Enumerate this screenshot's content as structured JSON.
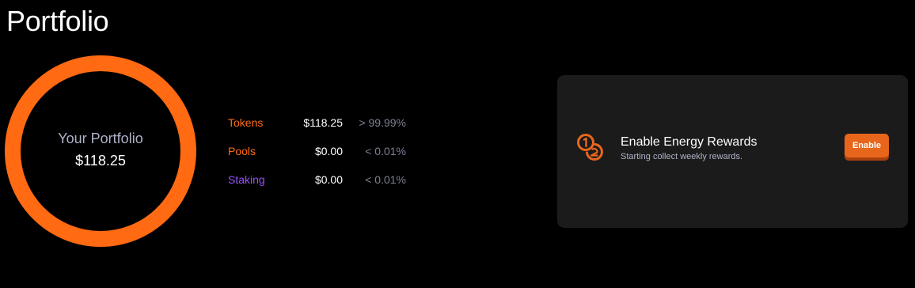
{
  "page": {
    "title": "Portfolio"
  },
  "portfolio": {
    "label": "Your Portfolio",
    "total": "$118.25"
  },
  "breakdown": [
    {
      "name": "Tokens",
      "amount": "$118.25",
      "percent": "> 99.99%",
      "color": "#ff6a13"
    },
    {
      "name": "Pools",
      "amount": "$0.00",
      "percent": "< 0.01%",
      "color": "#ff6a13"
    },
    {
      "name": "Staking",
      "amount": "$0.00",
      "percent": "< 0.01%",
      "color": "#9b4dff"
    }
  ],
  "donut": {
    "ring_color": "#ff6a13",
    "tokens_share": 0.9999
  },
  "rewards": {
    "icon": "coins-icon",
    "title": "Enable Energy Rewards",
    "subtitle": "Starting collect weekly rewards.",
    "button_label": "Enable",
    "accent": "#e8661c"
  }
}
